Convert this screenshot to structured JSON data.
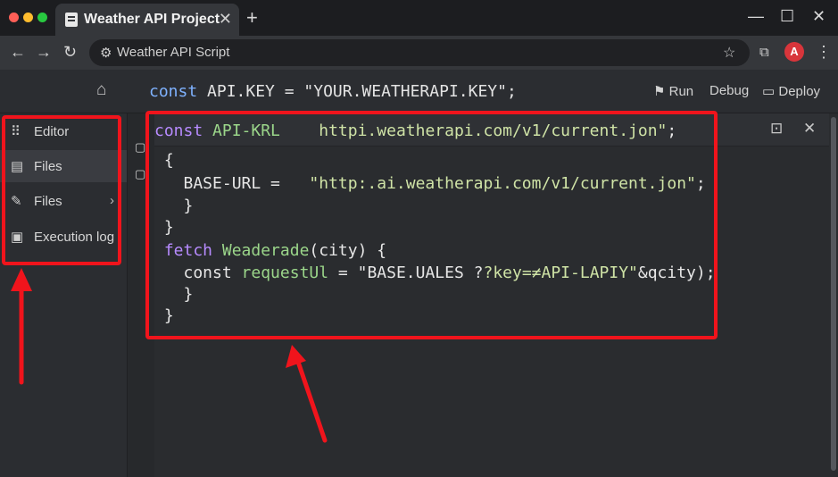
{
  "browser": {
    "tab_title": "Weather API Project",
    "tab_close": "✕",
    "new_tab": "+",
    "address": "Weather API Script",
    "window_controls": [
      "—",
      "☐",
      "✕"
    ],
    "avatar_letter": "A"
  },
  "toolbar": {
    "header_code": {
      "keyword": "const",
      "text": " API.KEY = \"YOUR.WEATHERAPI.KEY\";"
    },
    "buttons": [
      {
        "label": "Run",
        "icon": "run-icon"
      },
      {
        "label": "Debug",
        "icon": "debug-icon"
      },
      {
        "label": "Deploy",
        "icon": "deploy-icon"
      }
    ]
  },
  "sidebar": {
    "items": [
      {
        "label": "Editor",
        "icon": "grid-icon",
        "active": false
      },
      {
        "label": "Files",
        "icon": "file-icon",
        "active": true
      },
      {
        "label": "Files",
        "icon": "pencil-icon",
        "active": false,
        "chevron": "›"
      },
      {
        "label": "Execution log",
        "icon": "log-icon",
        "active": false
      }
    ]
  },
  "editor": {
    "lines": [
      {
        "kw": "const",
        "fn": " API-KRL",
        "rest": "    ",
        "str": "httpi.weatherapi.com/v1/current.jon\"",
        "end": ";"
      },
      {
        "text": " {"
      },
      {
        "text": "   BASE-URL =   ",
        "str": "\"http:.ai.weatherapi.com/v1/current.jon\"",
        "end": ";"
      },
      {
        "text": "   }"
      },
      {
        "text": " }"
      },
      {
        "kw": " fetch",
        "fn": " Weaderade",
        "rest": "(city) {"
      },
      {
        "text": "   const ",
        "fn": "requestUl",
        "rest": " = \"BASE.UALES ?",
        "str": "?key=≠API-LAPIY\"",
        "end": "&qcity);"
      },
      {
        "text": "   }"
      },
      {
        "text": " }"
      }
    ]
  },
  "colors": {
    "annotation": "#f0141c",
    "keyword": "#7fb2ff",
    "function": "#9bd68a",
    "string": "#cfe3a6"
  }
}
